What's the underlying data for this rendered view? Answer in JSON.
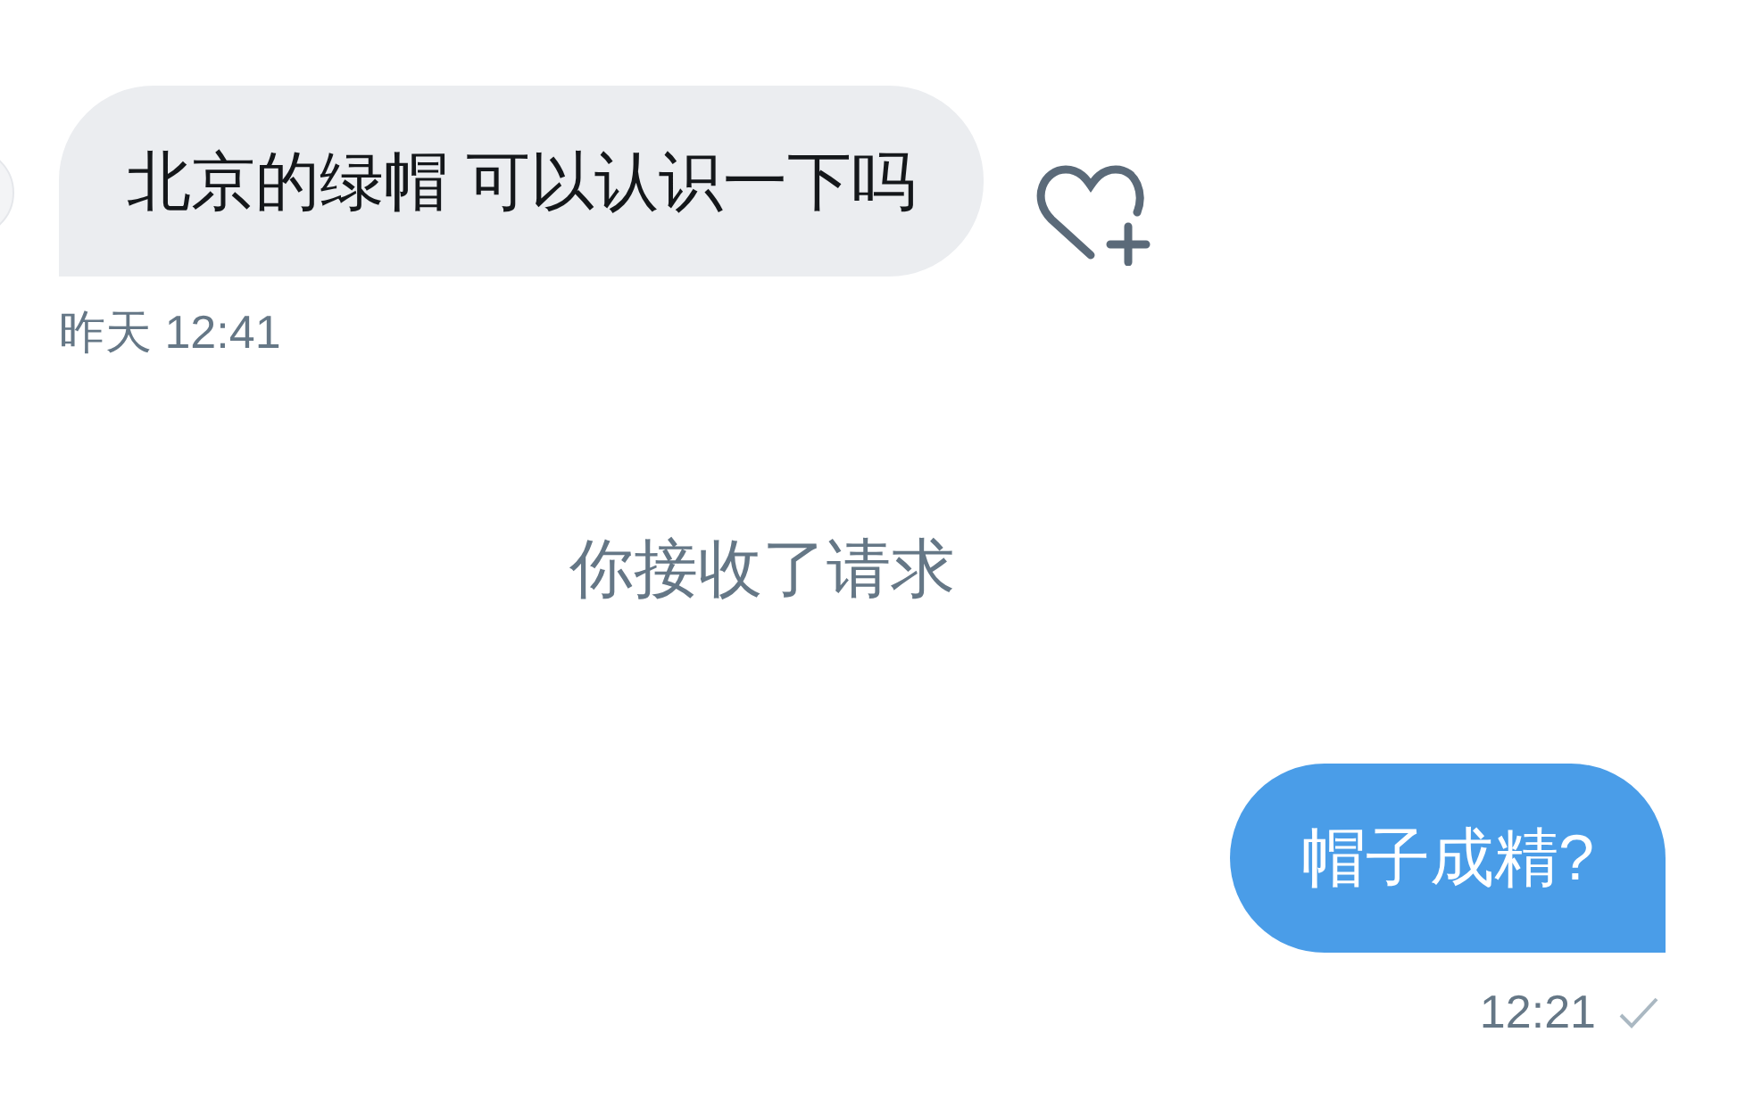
{
  "messages": [
    {
      "kind": "incoming",
      "text": "北京的绿帽 可以认识一下吗",
      "time": "昨天 12:41"
    },
    {
      "kind": "system",
      "text": "你接收了请求"
    },
    {
      "kind": "outgoing",
      "text": "帽子成精?",
      "time": "12:21"
    }
  ]
}
